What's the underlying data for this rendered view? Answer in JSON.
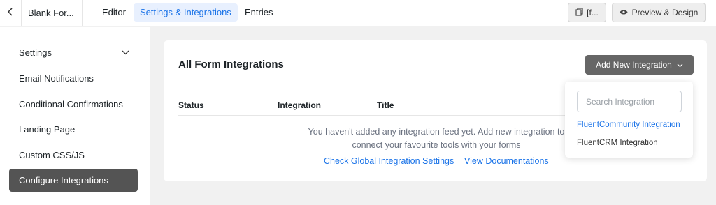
{
  "header": {
    "form_title": "Blank For...",
    "tabs": [
      {
        "label": "Editor"
      },
      {
        "label": "Settings & Integrations"
      },
      {
        "label": "Entries"
      }
    ],
    "shortcode_label": "[f...",
    "preview_label": "Preview & Design"
  },
  "sidebar": {
    "items": [
      {
        "label": "Settings"
      },
      {
        "label": "Email Notifications"
      },
      {
        "label": "Conditional Confirmations"
      },
      {
        "label": "Landing Page"
      },
      {
        "label": "Custom CSS/JS"
      },
      {
        "label": "Configure Integrations"
      }
    ]
  },
  "main": {
    "title": "All Form Integrations",
    "add_button_label": "Add New Integration",
    "columns": [
      "Status",
      "Integration",
      "Title"
    ],
    "empty_line1": "You haven't added any integration feed yet. Add new integration to",
    "empty_line2": "connect your favourite tools with your forms",
    "link_global": "Check Global Integration Settings",
    "link_docs": "View Documentations"
  },
  "dropdown": {
    "search_placeholder": "Search Integration",
    "items": [
      {
        "label": "FluentCommunity Integration"
      },
      {
        "label": "FluentCRM Integration"
      }
    ]
  },
  "colors": {
    "accent": "#1a73e8",
    "active_sidebar": "#545454",
    "add_button": "#666666"
  }
}
